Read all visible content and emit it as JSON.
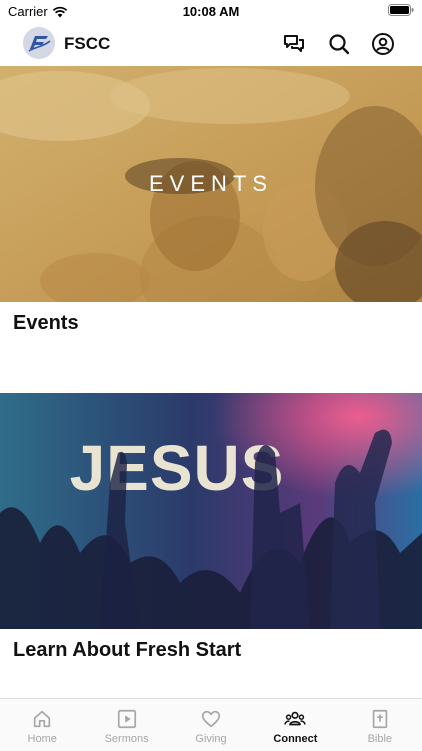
{
  "status_bar": {
    "carrier": "Carrier",
    "time": "10:08 AM"
  },
  "header": {
    "title": "FSCC",
    "logo_text": "FS"
  },
  "cards": [
    {
      "image_text": "EVENTS",
      "title": "Events"
    },
    {
      "image_text": "JESUS",
      "title": "Learn About Fresh Start"
    }
  ],
  "tabs": [
    {
      "label": "Home",
      "icon": "home-icon"
    },
    {
      "label": "Sermons",
      "icon": "play-icon"
    },
    {
      "label": "Giving",
      "icon": "heart-icon"
    },
    {
      "label": "Connect",
      "icon": "people-icon",
      "active": true
    },
    {
      "label": "Bible",
      "icon": "bible-icon"
    }
  ],
  "colors": {
    "events_tint": "#c8a35e",
    "jesus_tint": "#2e3b6e",
    "tab_inactive": "#a6a6a6"
  }
}
